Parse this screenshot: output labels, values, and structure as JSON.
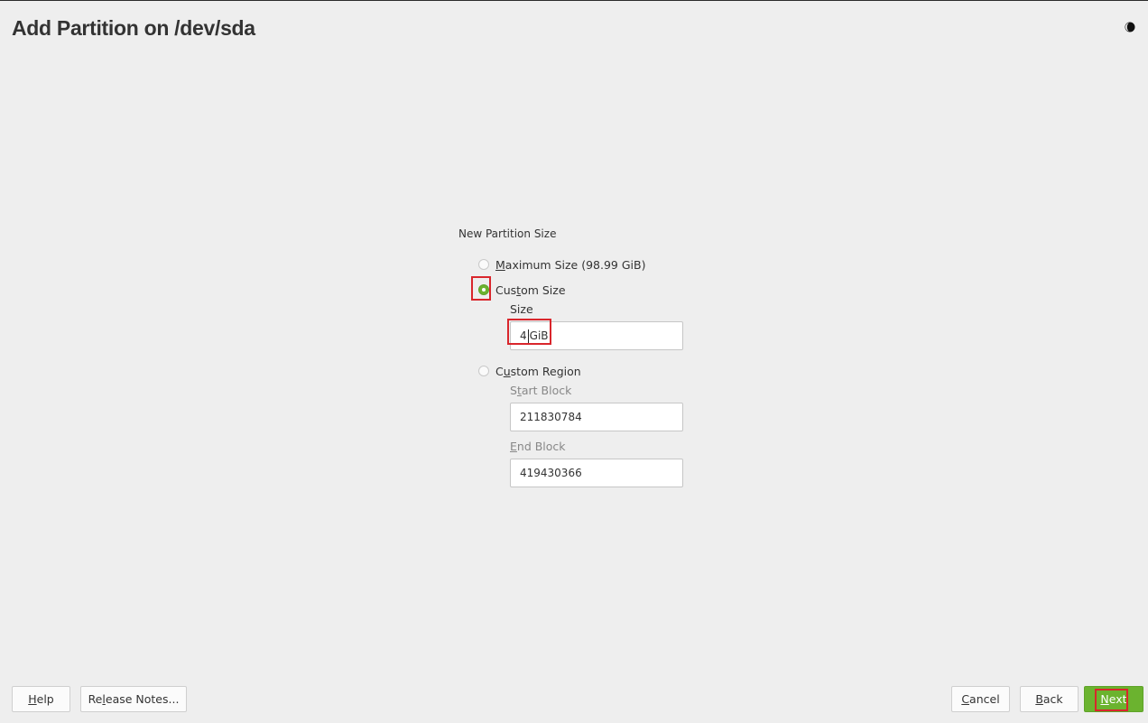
{
  "page": {
    "title": "Add Partition on /dev/sda"
  },
  "icons": {
    "theme_toggle": "half-moon-icon"
  },
  "partition_size": {
    "group_title": "New Partition Size",
    "options": [
      {
        "label_pre": "",
        "label_mnemonic": "M",
        "label_post": "aximum Size (98.99 GiB)",
        "checked": false
      },
      {
        "label_pre": "Cus",
        "label_mnemonic": "t",
        "label_post": "om Size",
        "checked": true
      },
      {
        "label_pre": "C",
        "label_mnemonic": "u",
        "label_post": "stom Region",
        "checked": false
      }
    ],
    "size": {
      "label": "Size",
      "value_before_caret": "4",
      "value_after_caret": "GiB"
    },
    "start_block": {
      "label_pre": "S",
      "label_mnemonic": "t",
      "label_post": "art Block",
      "value": "211830784"
    },
    "end_block": {
      "label_pre": "",
      "label_mnemonic": "E",
      "label_post": "nd Block",
      "value": "419430366"
    }
  },
  "footer": {
    "help": {
      "mnemonic": "H",
      "rest": "elp"
    },
    "release_notes": {
      "pre": "Re",
      "mnemonic": "l",
      "rest": "ease Notes..."
    },
    "cancel": {
      "mnemonic": "C",
      "rest": "ancel"
    },
    "back": {
      "mnemonic": "B",
      "rest": "ack"
    },
    "next": {
      "mnemonic": "N",
      "rest": "ext"
    }
  },
  "colors": {
    "accent": "#6bb32f",
    "highlight": "#d9262c",
    "background": "#eeeeee"
  }
}
